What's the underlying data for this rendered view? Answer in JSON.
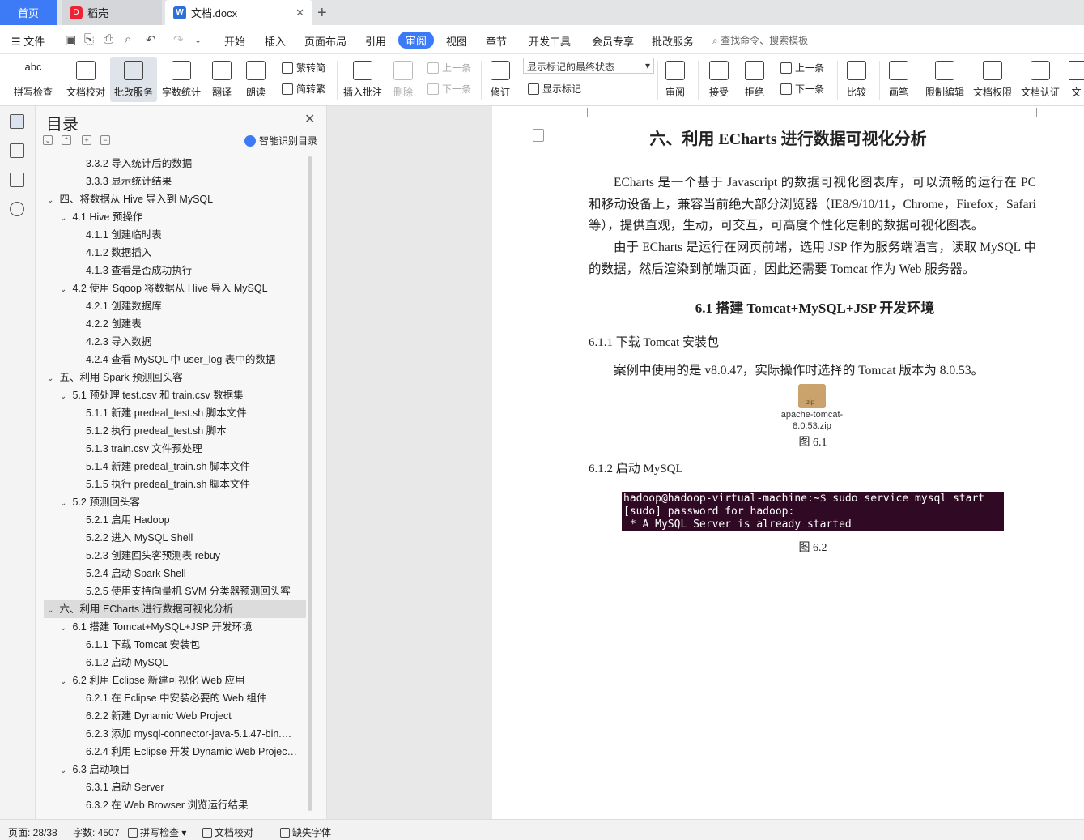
{
  "tabs": {
    "home": "首页",
    "daoke": "稻壳",
    "doc": "文档.docx"
  },
  "menu": {
    "file": "文件",
    "items": [
      "开始",
      "插入",
      "页面布局",
      "引用",
      "审阅",
      "视图",
      "章节",
      "开发工具",
      "会员专享",
      "批改服务"
    ],
    "search": "查找命令、搜索模板"
  },
  "ribbon": {
    "spell": "拼写检查",
    "proof": "文档校对",
    "correct": "批改服务",
    "wordcount": "字数统计",
    "translate": "翻译",
    "read": "朗读",
    "trad": "繁转简",
    "simp": "简转繁",
    "insert_comment": "插入批注",
    "delete": "删除",
    "prev": "上一条",
    "next": "下一条",
    "revise": "修订",
    "markup_select": "显示标记的最终状态",
    "show_markup": "显示标记",
    "review": "审阅",
    "accept": "接受",
    "reject": "拒绝",
    "prev2": "上一条",
    "next2": "下一条",
    "compare": "比较",
    "pen": "画笔",
    "restrict": "限制编辑",
    "rights": "文档权限",
    "cert": "文档认证",
    "more": "文"
  },
  "toc": {
    "title": "目录",
    "ai": "智能识别目录",
    "items": [
      {
        "text": "3.3.2  导入统计后的数据",
        "level": 3,
        "chev": ""
      },
      {
        "text": "3.3.3  显示统计结果",
        "level": 3,
        "chev": ""
      },
      {
        "text": "四、将数据从 Hive 导入到 MySQL",
        "level": 1,
        "chev": "v"
      },
      {
        "text": "4.1 Hive 预操作",
        "level": 2,
        "chev": "v"
      },
      {
        "text": "4.1.1  创建临时表",
        "level": 3,
        "chev": ""
      },
      {
        "text": "4.1.2  数据插入",
        "level": 3,
        "chev": ""
      },
      {
        "text": "4.1.3  查看是否成功执行",
        "level": 3,
        "chev": ""
      },
      {
        "text": "4.2  使用 Sqoop 将数据从 Hive 导入 MySQL",
        "level": 2,
        "chev": "v"
      },
      {
        "text": "4.2.1  创建数据库",
        "level": 3,
        "chev": ""
      },
      {
        "text": "4.2.2  创建表",
        "level": 3,
        "chev": ""
      },
      {
        "text": "4.2.3  导入数据",
        "level": 3,
        "chev": ""
      },
      {
        "text": "4.2.4  查看 MySQL 中 user_log 表中的数据",
        "level": 3,
        "chev": ""
      },
      {
        "text": "五、利用 Spark 预测回头客",
        "level": 1,
        "chev": "v"
      },
      {
        "text": "5.1  预处理 test.csv 和 train.csv 数据集",
        "level": 2,
        "chev": "v"
      },
      {
        "text": "5.1.1  新建 predeal_test.sh 脚本文件",
        "level": 3,
        "chev": ""
      },
      {
        "text": "5.1.2  执行 predeal_test.sh 脚本",
        "level": 3,
        "chev": ""
      },
      {
        "text": "5.1.3 train.csv 文件预处理",
        "level": 3,
        "chev": ""
      },
      {
        "text": "5.1.4  新建 predeal_train.sh 脚本文件",
        "level": 3,
        "chev": ""
      },
      {
        "text": "5.1.5  执行 predeal_train.sh 脚本文件",
        "level": 3,
        "chev": ""
      },
      {
        "text": "5.2  预测回头客",
        "level": 2,
        "chev": "v"
      },
      {
        "text": "5.2.1  启用 Hadoop",
        "level": 3,
        "chev": ""
      },
      {
        "text": "5.2.2  进入 MySQL Shell",
        "level": 3,
        "chev": ""
      },
      {
        "text": "5.2.3  创建回头客预测表 rebuy",
        "level": 3,
        "chev": ""
      },
      {
        "text": "5.2.4  启动 Spark Shell",
        "level": 3,
        "chev": ""
      },
      {
        "text": "5.2.5  使用支持向量机 SVM 分类器预测回头客",
        "level": 3,
        "chev": ""
      },
      {
        "text": "六、利用 ECharts 进行数据可视化分析",
        "level": 1,
        "chev": "v",
        "selected": true
      },
      {
        "text": "6.1 搭建 Tomcat+MySQL+JSP 开发环境",
        "level": 2,
        "chev": "v"
      },
      {
        "text": "6.1.1  下载 Tomcat 安装包",
        "level": 3,
        "chev": ""
      },
      {
        "text": "6.1.2  启动 MySQL",
        "level": 3,
        "chev": ""
      },
      {
        "text": "6.2 利用 Eclipse  新建可视化 Web 应用",
        "level": 2,
        "chev": "v"
      },
      {
        "text": "6.2.1  在 Eclipse 中安装必要的 Web 组件",
        "level": 3,
        "chev": ""
      },
      {
        "text": "6.2.2  新建 Dynamic Web Project",
        "level": 3,
        "chev": ""
      },
      {
        "text": "6.2.3  添加 mysql-connector-java-5.1.47-bin.…",
        "level": 3,
        "chev": ""
      },
      {
        "text": "6.2.4  利用 Eclipse  开发 Dynamic Web Projec…",
        "level": 3,
        "chev": ""
      },
      {
        "text": "6.3 启动项目",
        "level": 2,
        "chev": "v"
      },
      {
        "text": "6.3.1  启动 Server",
        "level": 3,
        "chev": ""
      },
      {
        "text": "6.3.2  在 Web Browser 浏览运行结果",
        "level": 3,
        "chev": ""
      }
    ]
  },
  "doc": {
    "heading": "六、利用 ECharts 进行数据可视化分析",
    "p1": "ECharts 是一个基于 Javascript 的数据可视化图表库，可以流畅的运行在  PC 和移动设备上，兼容当前绝大部分浏览器（IE8/9/10/11，Chrome，Firefox，Safari 等），提供直观，生动，可交互，可高度个性化定制的数据可视化图表。",
    "p2": "由于 ECharts 是运行在网页前端，选用 JSP 作为服务端语言，读取 MySQL 中的数据，然后渲染到前端页面，因此还需要 Tomcat 作为 Web 服务器。",
    "h2": "6.1 搭建 Tomcat+MySQL+JSP 开发环境",
    "h3_1": "6.1.1  下载 Tomcat 安装包",
    "p3": "案例中使用的是 v8.0.47，实际操作时选择的 Tomcat 版本为 8.0.53。",
    "zip_label": "zip",
    "zip_name_1": "apache-tomcat-",
    "zip_name_2": "8.0.53.zip",
    "fig1": "图 6.1",
    "h3_2": "6.1.2  启动 MySQL",
    "terminal": [
      "hadoop@hadoop-virtual-machine:~$ sudo service mysql start",
      "[sudo] password for hadoop:",
      " * A MySQL Server is already started"
    ],
    "fig2": "图 6.2"
  },
  "status": {
    "page": "页面: 28/38",
    "words": "字数: 4507",
    "spell": "拼写检查",
    "proof": "文档校对",
    "font": "缺失字体"
  }
}
